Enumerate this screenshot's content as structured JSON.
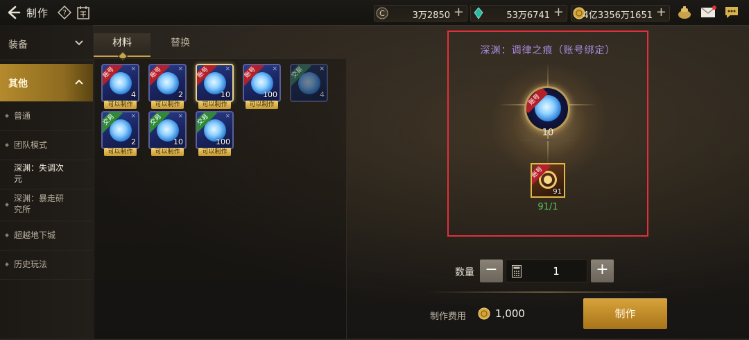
{
  "header": {
    "title": "制作",
    "currencies": [
      {
        "icon": "c-coin-icon",
        "value": "3万2850"
      },
      {
        "icon": "crystal-icon",
        "value": "53万6741"
      },
      {
        "icon": "gold-coin-icon",
        "value": "4亿3356万1651"
      }
    ],
    "right_icons": [
      "pot-icon",
      "mail-icon",
      "chat-icon"
    ]
  },
  "sidebar": {
    "categories": [
      {
        "label": "装备"
      },
      {
        "label": "其他"
      }
    ],
    "items": [
      {
        "label": "普通"
      },
      {
        "label": "团队模式"
      },
      {
        "label": "深渊：失调次元"
      },
      {
        "label": "深渊：暴走研究所"
      },
      {
        "label": "超越地下城"
      },
      {
        "label": "历史玩法"
      }
    ]
  },
  "tabs": [
    {
      "label": "材料"
    },
    {
      "label": "替换"
    }
  ],
  "grid": [
    {
      "ribbon": "账号",
      "qty": "4",
      "tag": "可以制作"
    },
    {
      "ribbon": "账号",
      "qty": "2",
      "tag": "可以制作"
    },
    {
      "ribbon": "账号",
      "qty": "10",
      "tag": "可以制作"
    },
    {
      "ribbon": "账号",
      "qty": "100",
      "tag": "可以制作"
    },
    {
      "ribbon": "交易",
      "qty": "4",
      "tag": ""
    },
    {
      "ribbon": "交易",
      "qty": "2",
      "tag": "可以制作"
    },
    {
      "ribbon": "交易",
      "qty": "10",
      "tag": "可以制作"
    },
    {
      "ribbon": "交易",
      "qty": "100",
      "tag": "可以制作"
    }
  ],
  "detail": {
    "name": "深渊：调律之痕（账号绑定）",
    "item_ribbon": "账号",
    "item_qty": "10",
    "material_ribbon": "账号",
    "material_qty": "91",
    "material_count": "91/1"
  },
  "quantity": {
    "label": "数量",
    "value": "1"
  },
  "cost": {
    "label": "制作费用",
    "value": "1,000"
  },
  "craft_label": "制作",
  "colors": {
    "accent_gold": "#c9a24a",
    "highlight_red": "#e3303a",
    "item_name_purple": "#a98be0",
    "count_green": "#5cc25c"
  }
}
